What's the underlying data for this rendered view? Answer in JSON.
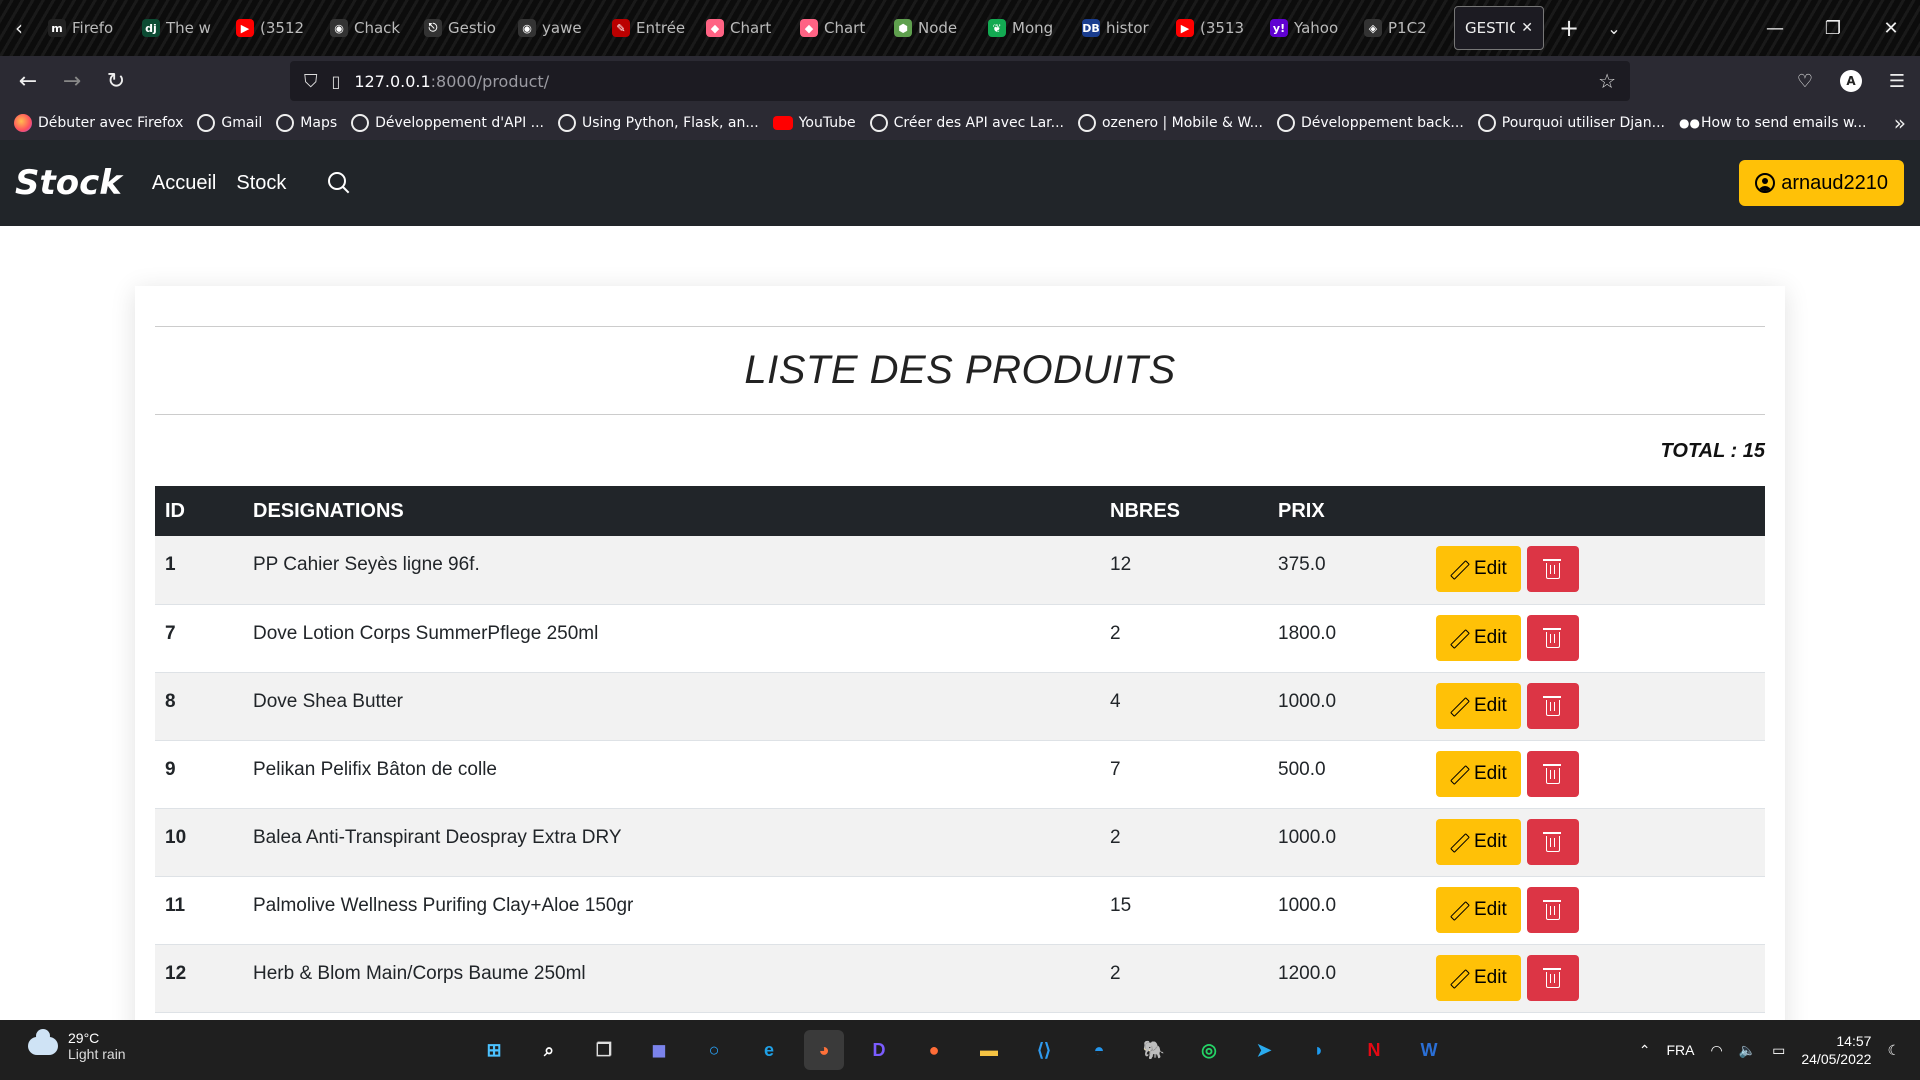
{
  "browser": {
    "tabs": [
      {
        "label": "Firefo",
        "fav": "m",
        "color": "#222"
      },
      {
        "label": "The w",
        "fav": "dj",
        "color": "#0c4b33"
      },
      {
        "label": "(3512",
        "fav": "▶",
        "color": "#ff0000"
      },
      {
        "label": "Chack",
        "fav": "◉",
        "color": "#333"
      },
      {
        "label": "Gestio",
        "fav": "⎋",
        "color": "#333"
      },
      {
        "label": "yawe",
        "fav": "◉",
        "color": "#333"
      },
      {
        "label": "Entrée",
        "fav": "✎",
        "color": "#b00"
      },
      {
        "label": "Chart",
        "fav": "◆",
        "color": "#ff6384"
      },
      {
        "label": "Chart",
        "fav": "◆",
        "color": "#ff6384"
      },
      {
        "label": "Node",
        "fav": "⬢",
        "color": "#5fa04e"
      },
      {
        "label": "Mong",
        "fav": "❦",
        "color": "#13aa52"
      },
      {
        "label": "histor",
        "fav": "DB",
        "color": "#1a3d8f"
      },
      {
        "label": "(3513",
        "fav": "▶",
        "color": "#ff0000"
      },
      {
        "label": "Yahoo",
        "fav": "y!",
        "color": "#6001d2"
      },
      {
        "label": "P1C2",
        "fav": "◈",
        "color": "#333"
      }
    ],
    "active_tab": "GESTIO",
    "url_host": "127.0.0.1",
    "url_path": ":8000/product/",
    "account_letter": "A",
    "bookmarks": [
      {
        "label": "Débuter avec Firefox",
        "icon": "firefox"
      },
      {
        "label": "Gmail",
        "icon": "globe"
      },
      {
        "label": "Maps",
        "icon": "globe"
      },
      {
        "label": "Développement d'API ...",
        "icon": "globe"
      },
      {
        "label": "Using Python, Flask, an...",
        "icon": "globe"
      },
      {
        "label": "YouTube",
        "icon": "youtube"
      },
      {
        "label": "Créer des API avec Lar...",
        "icon": "globe"
      },
      {
        "label": "ozenero | Mobile & W...",
        "icon": "globe"
      },
      {
        "label": "Développement back...",
        "icon": "globe"
      },
      {
        "label": "Pourquoi utiliser Djan...",
        "icon": "globe"
      },
      {
        "label": "How to send emails w...",
        "icon": "dots"
      }
    ]
  },
  "site": {
    "brand": "Stock",
    "nav": [
      "Accueil",
      "Stock"
    ],
    "user": "arnaud2210"
  },
  "page": {
    "title": "LISTE DES PRODUITS",
    "total_label": "TOTAL : 15",
    "columns": [
      "ID",
      "DESIGNATIONS",
      "NBRES",
      "PRIX",
      ""
    ],
    "edit_label": "Edit",
    "rows": [
      {
        "id": "1",
        "name": "PP Cahier Seyès ligne 96f.",
        "qty": "12",
        "price": "375.0"
      },
      {
        "id": "7",
        "name": "Dove Lotion Corps SummerPflege 250ml",
        "qty": "2",
        "price": "1800.0"
      },
      {
        "id": "8",
        "name": "Dove Shea Butter",
        "qty": "4",
        "price": "1000.0"
      },
      {
        "id": "9",
        "name": "Pelikan Pelifix Bâton de colle",
        "qty": "7",
        "price": "500.0"
      },
      {
        "id": "10",
        "name": "Balea Anti-Transpirant Deospray Extra DRY",
        "qty": "2",
        "price": "1000.0"
      },
      {
        "id": "11",
        "name": "Palmolive Wellness Purifing Clay+Aloe 150gr",
        "qty": "15",
        "price": "1000.0"
      },
      {
        "id": "12",
        "name": "Herb & Blom Main/Corps Baume 250ml",
        "qty": "2",
        "price": "1200.0"
      }
    ]
  },
  "taskbar": {
    "temp": "29°C",
    "weather": "Light rain",
    "lang": "FRA",
    "time": "14:57",
    "date": "24/05/2022",
    "apps": [
      {
        "name": "start-icon",
        "glyph": "⊞",
        "color": "#4cc2ff"
      },
      {
        "name": "search-icon",
        "glyph": "⌕",
        "color": "#fff"
      },
      {
        "name": "task-view-icon",
        "glyph": "❐",
        "color": "#ddd"
      },
      {
        "name": "chat-icon",
        "glyph": "◼",
        "color": "#7b83eb"
      },
      {
        "name": "cortana-icon",
        "glyph": "○",
        "color": "#2aa7ff"
      },
      {
        "name": "edge-icon",
        "glyph": "e",
        "color": "#1fa0e6"
      },
      {
        "name": "firefox-icon",
        "glyph": "◕",
        "color": "#ff7139"
      },
      {
        "name": "app-d-icon",
        "glyph": "D",
        "color": "#7b5cff"
      },
      {
        "name": "postman-icon",
        "glyph": "●",
        "color": "#ff6c37"
      },
      {
        "name": "files-icon",
        "glyph": "▬",
        "color": "#f5c343"
      },
      {
        "name": "vscode-icon",
        "glyph": "⟨⟩",
        "color": "#2f9bf0"
      },
      {
        "name": "docker-icon",
        "glyph": "◓",
        "color": "#2496ed"
      },
      {
        "name": "postgres-icon",
        "glyph": "🐘",
        "color": "#8fb0d8"
      },
      {
        "name": "whatsapp-icon",
        "glyph": "◎",
        "color": "#25d366"
      },
      {
        "name": "telegram-icon",
        "glyph": "➤",
        "color": "#2aabee"
      },
      {
        "name": "twitter-icon",
        "glyph": "◗",
        "color": "#1d9bf0"
      },
      {
        "name": "netflix-icon",
        "glyph": "N",
        "color": "#e50914"
      },
      {
        "name": "app-w-icon",
        "glyph": "W",
        "color": "#2a6fd6"
      }
    ]
  }
}
